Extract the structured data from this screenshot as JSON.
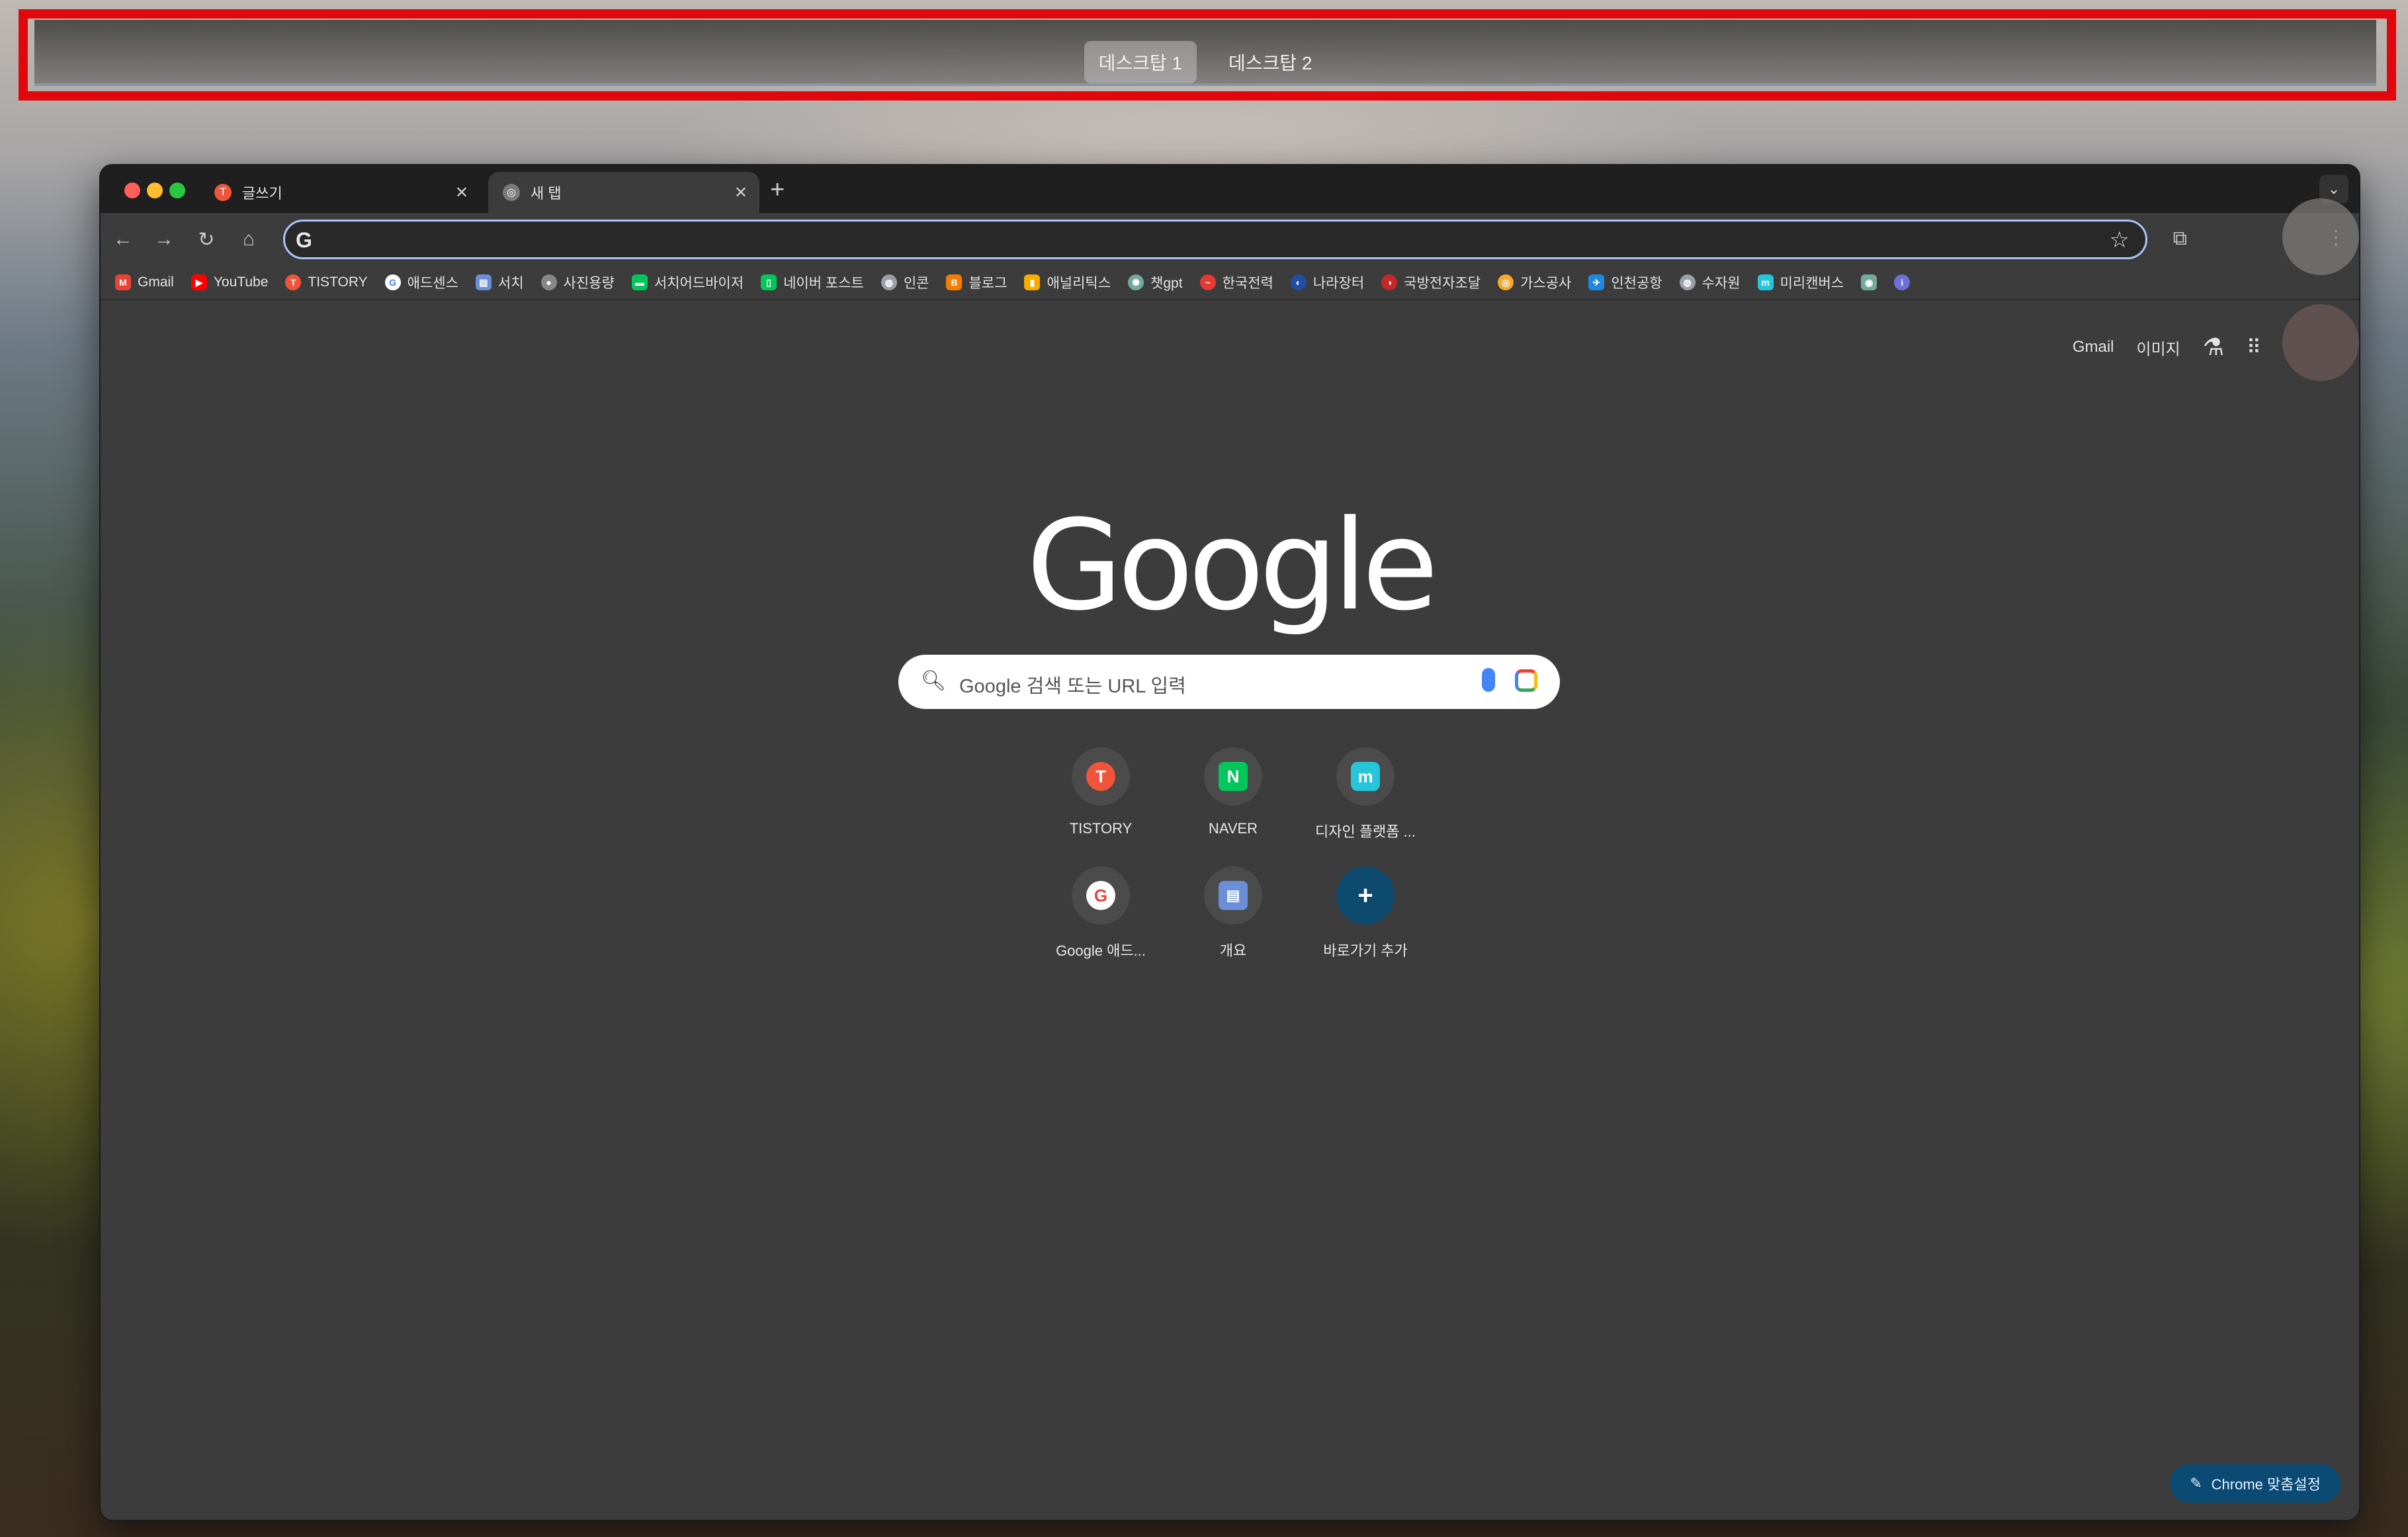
{
  "mission_control": {
    "desktops": [
      {
        "label": "데스크탑 1",
        "active": true
      },
      {
        "label": "데스크탑 2",
        "active": false
      }
    ]
  },
  "browser": {
    "tabs": [
      {
        "title": "글쓰기",
        "favicon": "tistory-icon",
        "active": false
      },
      {
        "title": "새 탭",
        "favicon": "chrome-icon",
        "active": true
      }
    ],
    "new_tab_label": "+",
    "address": {
      "value": "",
      "icon": "G"
    },
    "bookmarks": [
      {
        "label": "Gmail",
        "icon": "gmail-icon",
        "color": "#ea4335"
      },
      {
        "label": "YouTube",
        "icon": "youtube-icon",
        "color": "#ff0000"
      },
      {
        "label": "TISTORY",
        "icon": "tistory-icon",
        "color": "#f0543a"
      },
      {
        "label": "애드센스",
        "icon": "google-icon",
        "color": "#4285f4"
      },
      {
        "label": "서치",
        "icon": "search-console-icon",
        "color": "#6a8fd8"
      },
      {
        "label": "사진용량",
        "icon": "panda-icon",
        "color": "#888888"
      },
      {
        "label": "서치어드바이저",
        "icon": "naver-advisor-icon",
        "color": "#03c75a"
      },
      {
        "label": "네이버 포스트",
        "icon": "naver-post-icon",
        "color": "#03c75a"
      },
      {
        "label": "인콘",
        "icon": "globe-icon",
        "color": "#9aa0a6"
      },
      {
        "label": "블로그",
        "icon": "blogger-icon",
        "color": "#f57d00"
      },
      {
        "label": "애널리틱스",
        "icon": "analytics-icon",
        "color": "#f9ab00"
      },
      {
        "label": "챗gpt",
        "icon": "chatgpt-icon",
        "color": "#74aa9c"
      },
      {
        "label": "한국전력",
        "icon": "kepco-icon",
        "color": "#e53935"
      },
      {
        "label": "나라장터",
        "icon": "naramarket-icon",
        "color": "#1e4fa3"
      },
      {
        "label": "국방전자조달",
        "icon": "defense-icon",
        "color": "#c62828"
      },
      {
        "label": "가스공사",
        "icon": "gas-icon",
        "color": "#f9a825"
      },
      {
        "label": "인천공항",
        "icon": "airport-icon",
        "color": "#1e88e5"
      },
      {
        "label": "수자원",
        "icon": "globe-icon",
        "color": "#9aa0a6"
      },
      {
        "label": "미리캔버스",
        "icon": "miricanvas-icon",
        "color": "#26c6da"
      }
    ],
    "extra_bookmark_icons": [
      "app-icon",
      "extension-icon"
    ]
  },
  "ntp": {
    "top_links": {
      "gmail": "Gmail",
      "images": "이미지"
    },
    "logo_text": "Google",
    "search_placeholder": "Google 검색 또는 URL 입력",
    "shortcuts": [
      {
        "label": "TISTORY",
        "icon": "tistory-icon",
        "color": "#f0543a",
        "glyph": "T"
      },
      {
        "label": "NAVER",
        "icon": "naver-icon",
        "color": "#03c75a",
        "glyph": "N"
      },
      {
        "label": "디자인 플랫폼 ...",
        "icon": "miricanvas-icon",
        "color": "#26c6da",
        "glyph": "m"
      },
      {
        "label": "Google 애드...",
        "icon": "google-icon",
        "color": "#ffffff",
        "glyph": "G"
      },
      {
        "label": "개요",
        "icon": "search-console-icon",
        "color": "#6a8fd8",
        "glyph": "▤"
      },
      {
        "label": "바로가기 추가",
        "icon": "plus-icon",
        "color": "#0e4a6e",
        "glyph": "+"
      }
    ],
    "customize_label": "Chrome 맞춤설정"
  }
}
